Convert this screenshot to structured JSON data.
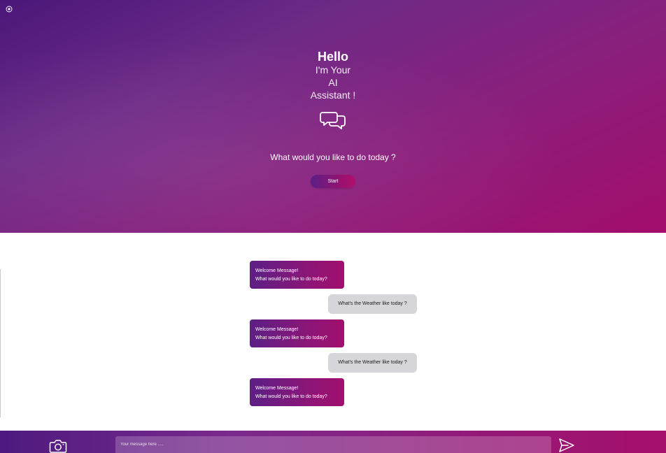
{
  "hero": {
    "greeting": "Hello",
    "line1": "I'm Your",
    "line2": "AI",
    "line3": "Assistant !",
    "question": "What would you like to do today ?",
    "start_label": "Start",
    "corner_icon": "settings-circle-icon",
    "chat_icon": "chat-bubbles-icon"
  },
  "messages": [
    {
      "from": "assistant",
      "line1": "Welcome Message!",
      "line2": "What would you like to do today?"
    },
    {
      "from": "user",
      "text": "What's the Weather like today ?"
    },
    {
      "from": "assistant",
      "line1": "Welcome Message!",
      "line2": "What would you like to do today?"
    },
    {
      "from": "user",
      "text": "What's the Weather like today ?"
    },
    {
      "from": "assistant",
      "line1": "Welcome Message!",
      "line2": "What would you like to do today?"
    }
  ],
  "input": {
    "placeholder": "Your message here .....",
    "value": "",
    "camera_icon": "camera-icon",
    "send_icon": "send-icon"
  },
  "colors": {
    "gradient_start": "#4a1779",
    "gradient_end": "#a30d6c",
    "user_bubble": "#d5d5da"
  }
}
